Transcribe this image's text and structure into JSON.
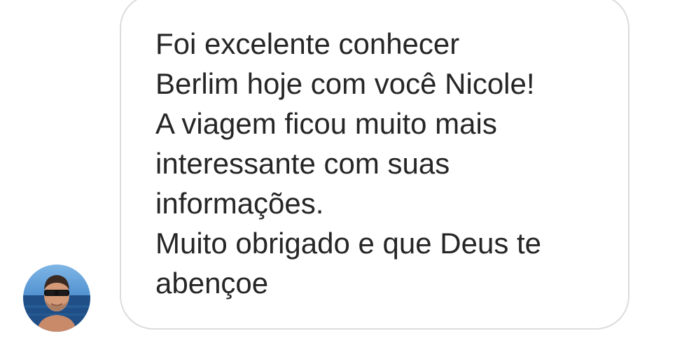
{
  "conversation": {
    "incoming_message": {
      "lines": [
        "Foi excelente conhecer",
        "Berlim hoje com você Nicole!",
        "A viagem ficou muito mais",
        "interessante com suas",
        "informações.",
        "Muito obrigado e que Deus te",
        "abençoe"
      ]
    },
    "sender_avatar": {
      "icon": "user-avatar-photo"
    }
  },
  "colors": {
    "bubble_border": "#dcdcdc",
    "bubble_background": "#ffffff",
    "text": "#262626",
    "page_background": "#ffffff"
  }
}
